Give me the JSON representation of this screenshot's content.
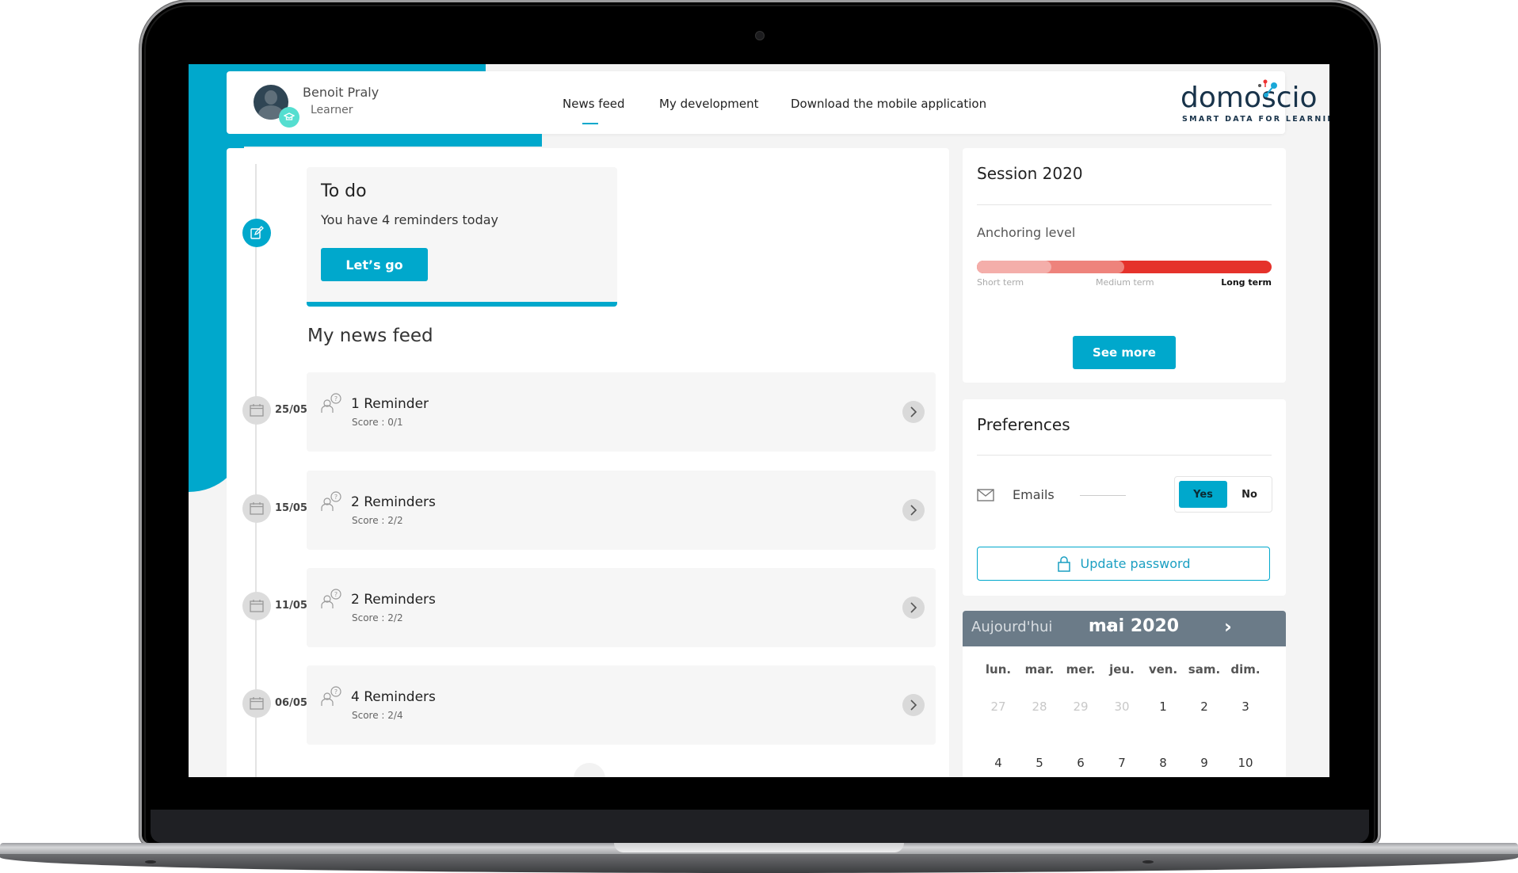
{
  "header": {
    "user_name": "Benoit Praly",
    "user_role": "Learner",
    "nav": [
      {
        "label": "News feed",
        "active": true
      },
      {
        "label": "My development",
        "active": false
      },
      {
        "label": "Download the mobile application",
        "active": false
      }
    ],
    "logo_text": "domoscio",
    "logo_tagline": "SMART DATA FOR LEARNING"
  },
  "todo": {
    "title": "To do",
    "subtitle": "You have 4 reminders today",
    "button_label": "Let’s go"
  },
  "feed": {
    "title": "My news feed",
    "items": [
      {
        "date": "25/05",
        "label": "1 Reminder",
        "score": "Score : 0/1"
      },
      {
        "date": "15/05",
        "label": "2 Reminders",
        "score": "Score : 2/2"
      },
      {
        "date": "11/05",
        "label": "2 Reminders",
        "score": "Score : 2/2"
      },
      {
        "date": "06/05",
        "label": "4 Reminders",
        "score": "Score : 2/4"
      }
    ]
  },
  "session": {
    "title": "Session 2020",
    "anchoring_label": "Anchoring level",
    "levels": [
      "Short term",
      "Medium term",
      "Long term"
    ],
    "current_level": "Long term",
    "colors": {
      "short": "#f4aeaa",
      "medium": "#ee837c",
      "long": "#e5322b"
    },
    "button_label": "See more"
  },
  "preferences": {
    "title": "Preferences",
    "emails_label": "Emails",
    "toggle_yes": "Yes",
    "toggle_no": "No",
    "emails_selected": "Yes",
    "update_password_label": "Update password"
  },
  "calendar": {
    "today_label": "Aujourd'hui",
    "month_label": "mai 2020",
    "prev": "‹",
    "next": "›",
    "weekdays": [
      "lun.",
      "mar.",
      "mer.",
      "jeu.",
      "ven.",
      "sam.",
      "dim."
    ],
    "weeks": [
      [
        {
          "d": "27",
          "muted": true
        },
        {
          "d": "28",
          "muted": true
        },
        {
          "d": "29",
          "muted": true
        },
        {
          "d": "30",
          "muted": true
        },
        {
          "d": "1",
          "muted": false
        },
        {
          "d": "2",
          "muted": false
        },
        {
          "d": "3",
          "muted": false
        }
      ],
      [
        {
          "d": "4",
          "muted": false
        },
        {
          "d": "5",
          "muted": false
        },
        {
          "d": "6",
          "muted": false
        },
        {
          "d": "7",
          "muted": false
        },
        {
          "d": "8",
          "muted": false
        },
        {
          "d": "9",
          "muted": false
        },
        {
          "d": "10",
          "muted": false
        }
      ]
    ]
  },
  "colors": {
    "accent": "#00a8cc",
    "calendar_header": "#6b7b88"
  }
}
